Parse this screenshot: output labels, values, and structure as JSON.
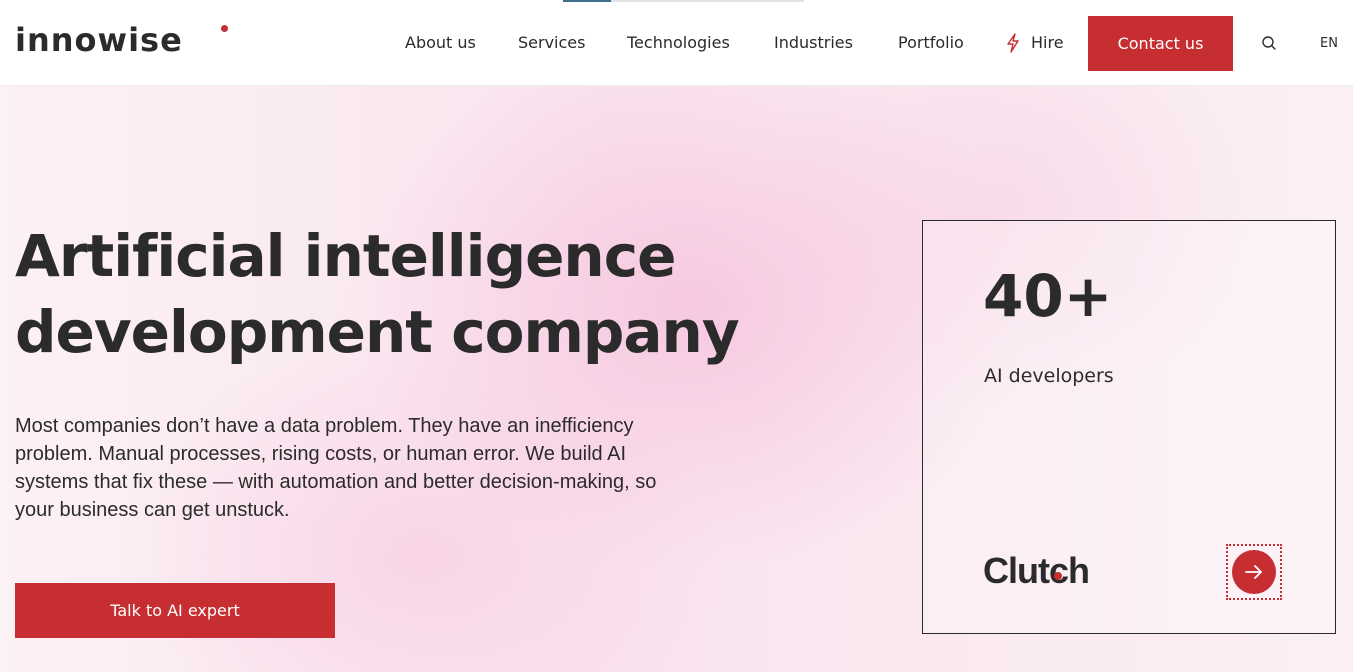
{
  "header": {
    "logo_text": "innowise",
    "scroll_progress": 0.2,
    "nav": [
      {
        "label": "About us"
      },
      {
        "label": "Services"
      },
      {
        "label": "Technologies"
      },
      {
        "label": "Industries"
      },
      {
        "label": "Portfolio"
      },
      {
        "label": "Hire"
      }
    ],
    "hire_icon": "lightning-icon",
    "contact_label": "Contact us",
    "search_icon": "search-icon",
    "language": "EN"
  },
  "hero": {
    "title_line1": "Artificial intelligence",
    "title_line2": "development company",
    "description": "Most companies don’t have a data problem. They have an inefficiency problem. Manual processes, rising costs, or human error. We build AI systems that fix these — with automation and better decision-making, so your business can get unstuck.",
    "cta_label": "Talk to AI expert"
  },
  "stat_card": {
    "value": "40+",
    "label": "AI developers",
    "brand": "Clutch",
    "arrow_icon": "arrow-right-icon"
  },
  "colors": {
    "accent": "#c62e31",
    "text": "#2b2b2b",
    "progress": "#3f6f8c"
  }
}
